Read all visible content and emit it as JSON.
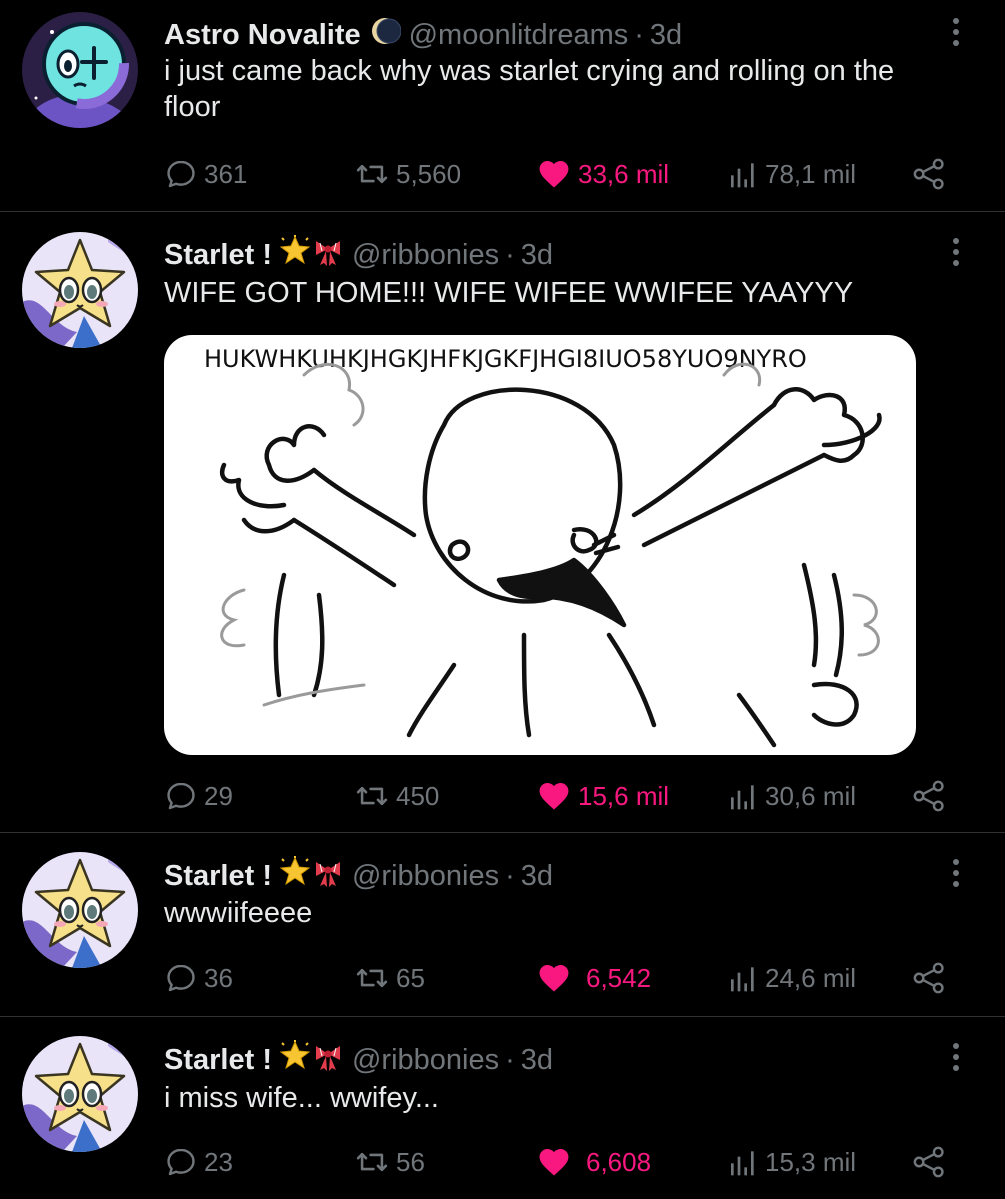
{
  "posts": [
    {
      "display_name": "Astro Novalite",
      "emoji": "moon-icon",
      "handle": "@moonlitdreams",
      "separator": "·",
      "time": "3d",
      "text": "i just came back why was starlet crying and rolling on the floor",
      "replies": "361",
      "reposts": "5,560",
      "likes": "33,6 mil",
      "views": "78,1 mil"
    },
    {
      "display_name": "Starlet !",
      "emoji": "star-and-ribbon-icon",
      "handle": "@ribbonies",
      "separator": "·",
      "time": "3d",
      "text": "WIFE GOT HOME!!! WIFE WIFEE WWIFEE YAAYYY",
      "media_caption": "HUKWHKUHKJHGKJHFKJGKFJHGI8IUO58YUO9NYRO",
      "replies": "29",
      "reposts": "450",
      "likes": "15,6 mil",
      "views": "30,6 mil"
    },
    {
      "display_name": "Starlet !",
      "emoji": "star-and-ribbon-icon",
      "handle": "@ribbonies",
      "separator": "·",
      "time": "3d",
      "text": "wwwiifeeee",
      "replies": "36",
      "reposts": "65",
      "likes": "6,542",
      "views": "24,6 mil"
    },
    {
      "display_name": "Starlet !",
      "emoji": "star-and-ribbon-icon",
      "handle": "@ribbonies",
      "separator": "·",
      "time": "3d",
      "text": "i miss wife... wwifey...",
      "replies": "23",
      "reposts": "56",
      "likes": "6,608",
      "views": "15,3 mil"
    }
  ],
  "colors": {
    "background": "#000000",
    "text": "#e7e9ea",
    "muted": "#71767b",
    "like": "#f91880",
    "divider": "#2f3336"
  }
}
